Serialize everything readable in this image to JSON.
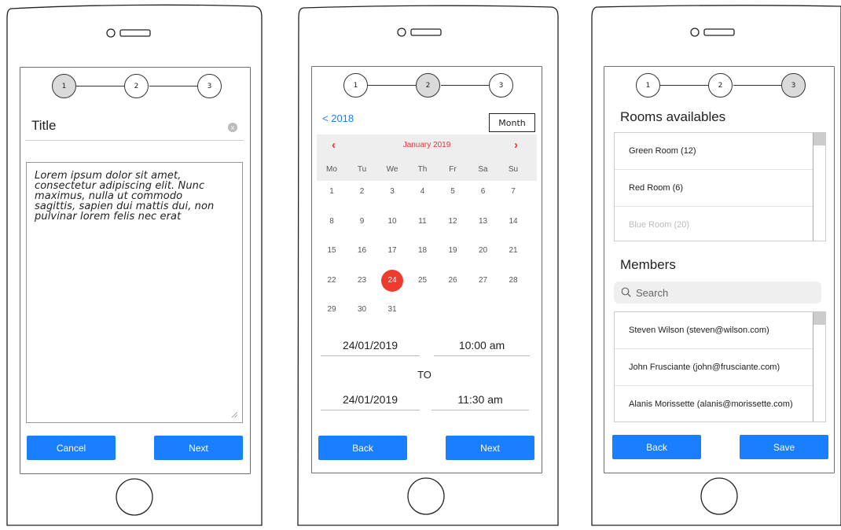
{
  "screens": [
    {
      "steps": [
        "1",
        "2",
        "3"
      ],
      "active_step": 1,
      "title_label": "Title",
      "clear_icon": "x",
      "body_lines": [
        "Lorem ipsum dolor sit amet,",
        "consectetur adipiscing elit. Nunc",
        "maximus, nulla ut commodo",
        "sagittis, sapien dui mattis dui, non",
        "pulvinar lorem felis nec erat"
      ],
      "left_button": "Cancel",
      "right_button": "Next"
    },
    {
      "steps": [
        "1",
        "2",
        "3"
      ],
      "active_step": 2,
      "back_year": "2018",
      "back_year_chevron": "<",
      "month_button": "Month",
      "calendar": {
        "prev": "‹",
        "next": "›",
        "month": "January 2019",
        "weekdays": [
          "Mo",
          "Tu",
          "We",
          "Th",
          "Fr",
          "Sa",
          "Su"
        ],
        "weeks": [
          [
            "1",
            "2",
            "3",
            "4",
            "5",
            "6",
            "7"
          ],
          [
            "8",
            "9",
            "10",
            "11",
            "12",
            "13",
            "14"
          ],
          [
            "15",
            "16",
            "17",
            "18",
            "19",
            "20",
            "21"
          ],
          [
            "22",
            "23",
            "24",
            "25",
            "26",
            "27",
            "28"
          ],
          [
            "29",
            "30",
            "31"
          ]
        ],
        "selected_day": "24"
      },
      "start_date": "24/01/2019",
      "start_time": "10:00 am",
      "to_label": "TO",
      "end_date": "24/01/2019",
      "end_time": "11:30 am",
      "left_button": "Back",
      "right_button": "Next"
    },
    {
      "steps": [
        "1",
        "2",
        "3"
      ],
      "active_step": 3,
      "rooms_title": "Rooms availables",
      "rooms": [
        {
          "label": "Green Room (12)",
          "disabled": false
        },
        {
          "label": "Red Room (6)",
          "disabled": false
        },
        {
          "label": "Blue Room (20)",
          "disabled": true
        }
      ],
      "members_title": "Members",
      "search_placeholder": "Search",
      "members": [
        "Steven Wilson (steven@wilson.com)",
        "John Frusciante (john@frusciante.com)",
        "Alanis Morissette (alanis@morissette.com)"
      ],
      "left_button": "Back",
      "right_button": "Save"
    }
  ],
  "colors": {
    "primary_button": "#1a7fff",
    "calendar_accent": "#ef3b2d",
    "active_step": "#dadada"
  }
}
